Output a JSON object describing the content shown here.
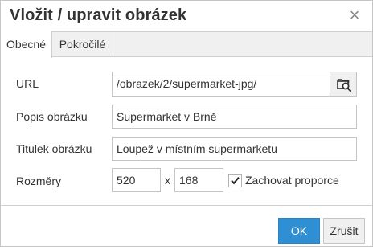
{
  "dialog": {
    "title": "Vložit / upravit obrázek",
    "close_glyph": "×"
  },
  "tabs": [
    {
      "label": "Obecné"
    },
    {
      "label": "Pokročilé"
    }
  ],
  "form": {
    "url_label": "URL",
    "url_value": "/obrazek/2/supermarket-jpg/",
    "description_label": "Popis obrázku",
    "description_value": "Supermarket v Brně",
    "title_label": "Titulek obrázku",
    "title_value": "Loupež v místním supermarketu",
    "dimensions_label": "Rozměry",
    "width_value": "520",
    "times": "x",
    "height_value": "168",
    "constrain_label": "Zachovat proporce",
    "constrain_checked": true
  },
  "buttons": {
    "ok": "OK",
    "cancel": "Zrušit"
  },
  "colors": {
    "primary": "#2e8fd4",
    "border": "#c5c5c5",
    "text": "#333333"
  },
  "icons": {
    "browse": "browse-image-icon",
    "close": "close-icon",
    "check": "checkmark-icon"
  }
}
